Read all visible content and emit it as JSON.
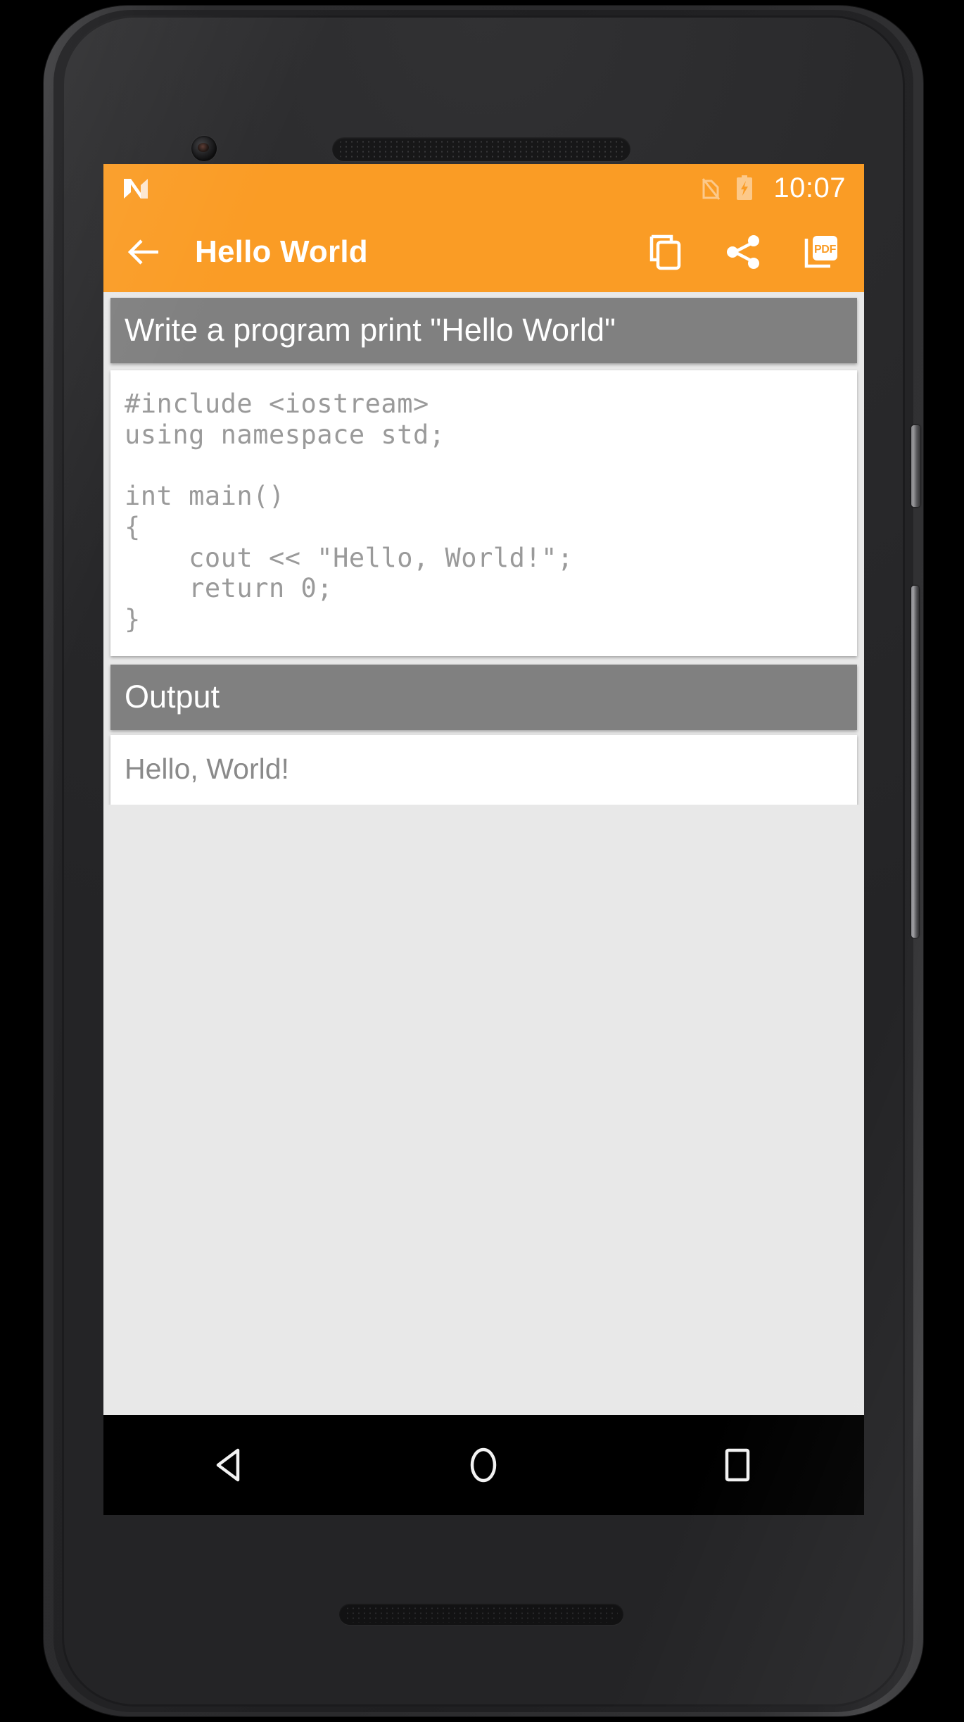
{
  "device": {
    "kind": "android-phone-mockup",
    "nav_bar": {
      "back_label": "Back",
      "home_label": "Home",
      "recents_label": "Recent apps"
    }
  },
  "status_bar": {
    "logo": "android-n-logo",
    "icons": [
      "no-sim-icon",
      "battery-charging-icon"
    ],
    "time": "10:07",
    "background": "#fa9c25"
  },
  "app_bar": {
    "back_icon": "back-arrow-icon",
    "title": "Hello World",
    "actions": [
      {
        "name": "copy-icon",
        "label": "Copy"
      },
      {
        "name": "share-icon",
        "label": "Share"
      },
      {
        "name": "pdf-icon",
        "label": "PDF"
      }
    ],
    "background": "#fa9c25",
    "title_color": "#ffffff"
  },
  "main": {
    "question": {
      "header": "Write a program print \"Hello World\"",
      "header_bg": "#808080",
      "header_color": "#ffffff"
    },
    "code": {
      "language": "cpp",
      "text": "#include <iostream>\nusing namespace std;\n\nint main()\n{\n    cout << \"Hello, World!\";\n    return 0;\n}",
      "bg": "#ffffff",
      "color": "#9a9a9a"
    },
    "output": {
      "header": "Output",
      "header_bg": "#808080",
      "text": "Hello, World!",
      "bg": "#ffffff",
      "color": "#8a8a8a"
    },
    "page_bg": "#e8e8e8"
  }
}
